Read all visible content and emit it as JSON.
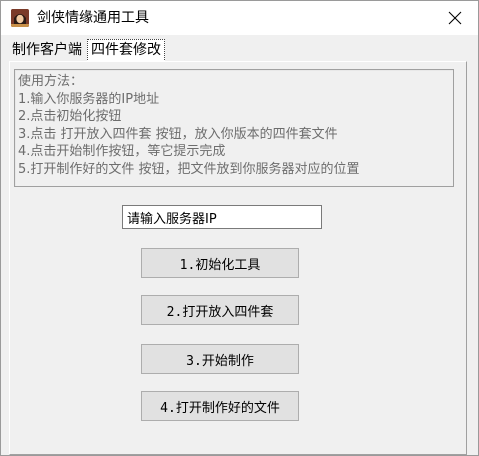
{
  "window": {
    "title": "剑侠情缘通用工具",
    "icon": "game-character-icon",
    "close_icon": "close-icon"
  },
  "tabs": [
    {
      "label": "制作客户端",
      "active": false
    },
    {
      "label": "四件套修改",
      "active": true
    }
  ],
  "instructions": {
    "lines": [
      "使用方法：",
      "1.输入你服务器的IP地址",
      "2.点击初始化按钮",
      "3.点击 打开放入四件套 按钮，放入你版本的四件套文件",
      "4.点击开始制作按钮，等它提示完成",
      "5.打开制作好的文件 按钮，把文件放到你服务器对应的位置"
    ]
  },
  "server_input": {
    "value": "请输入服务器IP"
  },
  "buttons": {
    "init": "1.初始化工具",
    "open_four_set": "2.打开放入四件套",
    "start": "3.开始制作",
    "open_output": "4.打开制作好的文件"
  }
}
